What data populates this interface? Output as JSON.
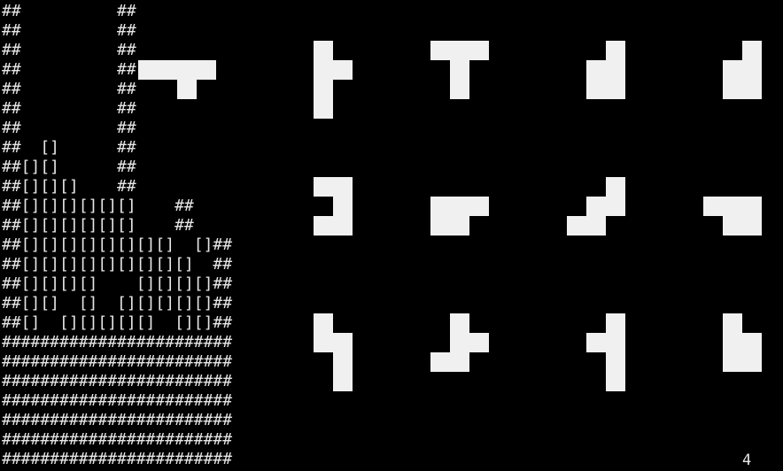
{
  "board": {
    "rows": [
      "##          ##",
      "##          ##",
      "##          ##",
      "##          ##",
      "##          ##",
      "##          ##",
      "##          ##",
      "##  []      ##",
      "##[][]      ##",
      "##[][][]    ##",
      "##[][][][][][]    ##",
      "##[][][][][][]    ##",
      "##[][][][][][][][]  []##",
      "##[][][][][][][][][]  ##",
      "##[][][][]    [][][][]##",
      "##[][]  []  [][][][][]##",
      "##[]  [][][][][]  [][]##",
      "########################",
      "########################",
      "########################",
      "########################",
      "########################",
      "########################",
      "########################"
    ],
    "falling_piece": {
      "name": "T",
      "cells": [
        [
          0,
          0
        ],
        [
          1,
          0
        ],
        [
          2,
          0
        ],
        [
          3,
          0
        ],
        [
          2,
          1
        ]
      ],
      "color": "#f0f0f0"
    }
  },
  "pieces": [
    {
      "name": "T-left",
      "cells": [
        [
          0,
          0
        ],
        [
          0,
          1
        ],
        [
          1,
          1
        ],
        [
          0,
          2
        ],
        [
          0,
          3
        ]
      ]
    },
    {
      "name": "T-down",
      "cells": [
        [
          0,
          0
        ],
        [
          1,
          0
        ],
        [
          2,
          0
        ],
        [
          1,
          1
        ],
        [
          1,
          2
        ]
      ]
    },
    {
      "name": "P-right",
      "cells": [
        [
          1,
          0
        ],
        [
          0,
          1
        ],
        [
          1,
          1
        ],
        [
          0,
          2
        ],
        [
          1,
          2
        ]
      ]
    },
    {
      "name": "P-right-b",
      "cells": [
        [
          1,
          0
        ],
        [
          0,
          1
        ],
        [
          1,
          1
        ],
        [
          0,
          2
        ],
        [
          1,
          2
        ]
      ]
    },
    {
      "name": "U-right",
      "cells": [
        [
          0,
          0
        ],
        [
          1,
          0
        ],
        [
          1,
          1
        ],
        [
          0,
          2
        ],
        [
          1,
          2
        ]
      ]
    },
    {
      "name": "P-down",
      "cells": [
        [
          0,
          1
        ],
        [
          1,
          1
        ],
        [
          2,
          1
        ],
        [
          0,
          2
        ],
        [
          1,
          2
        ]
      ]
    },
    {
      "name": "W",
      "cells": [
        [
          2,
          0
        ],
        [
          1,
          1
        ],
        [
          2,
          1
        ],
        [
          0,
          2
        ],
        [
          1,
          2
        ]
      ]
    },
    {
      "name": "P-up",
      "cells": [
        [
          0,
          1
        ],
        [
          1,
          1
        ],
        [
          2,
          1
        ],
        [
          1,
          2
        ],
        [
          2,
          2
        ]
      ]
    },
    {
      "name": "N",
      "cells": [
        [
          0,
          0
        ],
        [
          0,
          1
        ],
        [
          1,
          1
        ],
        [
          1,
          2
        ],
        [
          1,
          3
        ]
      ]
    },
    {
      "name": "F",
      "cells": [
        [
          1,
          0
        ],
        [
          1,
          1
        ],
        [
          2,
          1
        ],
        [
          0,
          2
        ],
        [
          1,
          2
        ]
      ]
    },
    {
      "name": "Y",
      "cells": [
        [
          1,
          0
        ],
        [
          0,
          1
        ],
        [
          1,
          1
        ],
        [
          1,
          2
        ],
        [
          1,
          3
        ]
      ]
    },
    {
      "name": "P-left",
      "cells": [
        [
          0,
          0
        ],
        [
          0,
          1
        ],
        [
          1,
          1
        ],
        [
          0,
          2
        ],
        [
          1,
          2
        ]
      ]
    }
  ],
  "score": "4",
  "colors": {
    "background": "#000000",
    "text": "#e6e6e6",
    "block": "#f0f0f0"
  }
}
